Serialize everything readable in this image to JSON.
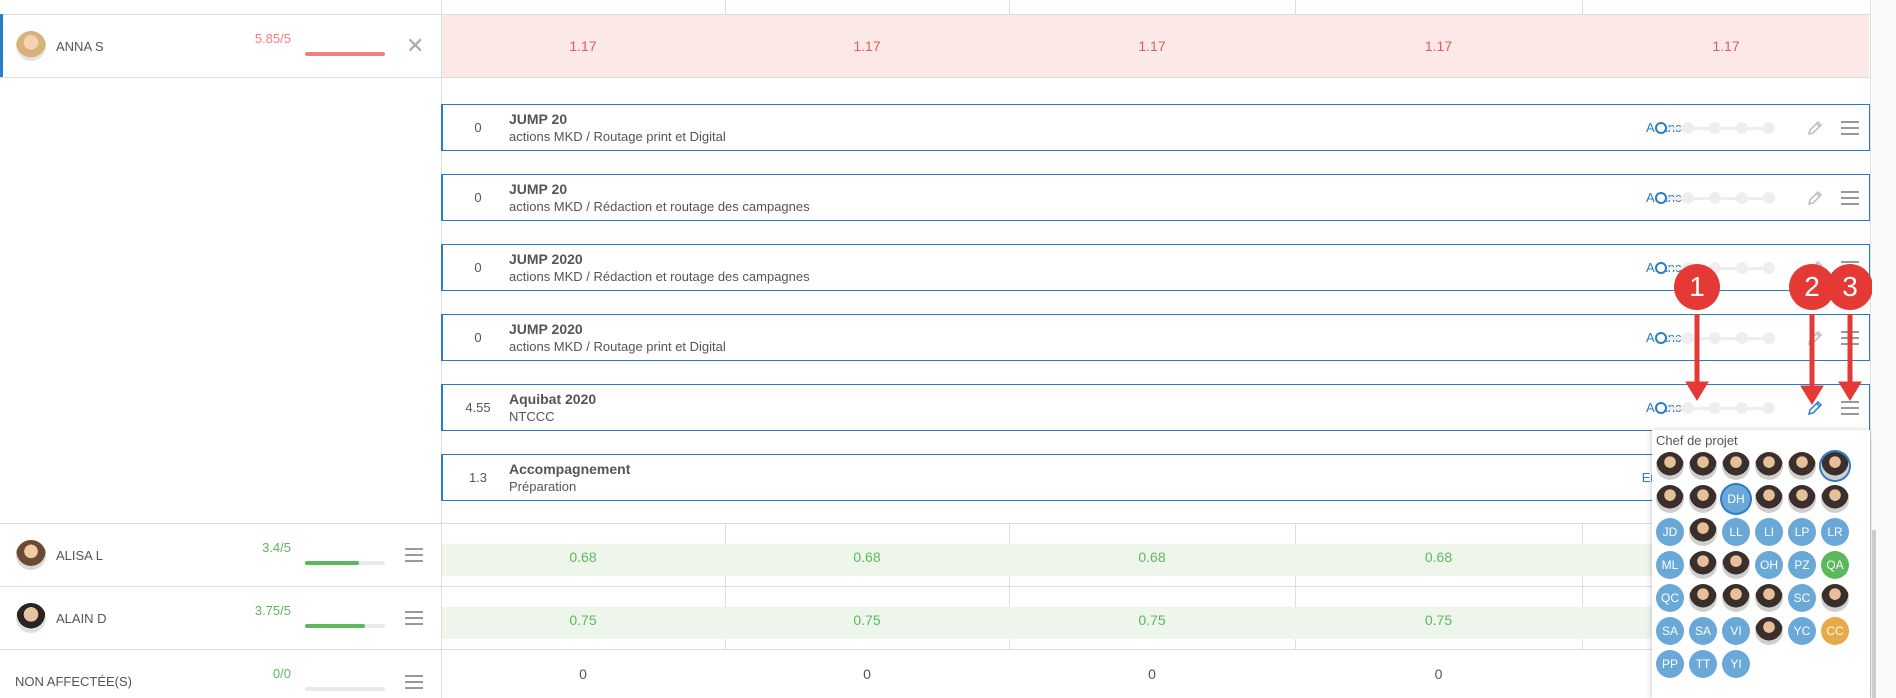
{
  "people": [
    {
      "name": "ANNA S",
      "score": "5.85/5",
      "score_color": "#f08080",
      "bar_fraction": 1.0,
      "action": "close"
    },
    {
      "name": "ALISA L",
      "score": "3.4/5",
      "score_color": "#5cb85c",
      "bar_fraction": 0.68,
      "action": "menu"
    },
    {
      "name": "ALAIN D",
      "score": "3.75/5",
      "score_color": "#5cb85c",
      "bar_fraction": 0.75,
      "action": "menu"
    },
    {
      "name": "NON AFFECTÉE(S)",
      "score": "0/0",
      "score_color": "#5cb85c",
      "bar_fraction": 0.0,
      "action": "menu"
    }
  ],
  "grid_rows": [
    {
      "values": [
        "1.17",
        "1.17",
        "1.17",
        "1.17",
        "1.17"
      ],
      "color": "#e05c5c",
      "bg": "#fde8e8"
    },
    {
      "values": [
        "0.68",
        "0.68",
        "0.68",
        "0.68",
        ""
      ],
      "color": "#5cb85c",
      "bg": "#eef6ec"
    },
    {
      "values": [
        "0.75",
        "0.75",
        "0.75",
        "0.75",
        ""
      ],
      "color": "#5cb85c",
      "bg": "#eef6ec"
    },
    {
      "values": [
        "0",
        "0",
        "0",
        "0",
        ""
      ],
      "color": "#555555",
      "bg": "#ffffff"
    }
  ],
  "tasks": [
    {
      "num": "0",
      "title": "JUMP 20",
      "subtitle": "actions MKD / Routage print et Digital",
      "status": "A lancer"
    },
    {
      "num": "0",
      "title": "JUMP 20",
      "subtitle": "actions MKD / Rédaction et routage des campagnes",
      "status": "A lancer"
    },
    {
      "num": "0",
      "title": "JUMP 2020",
      "subtitle": "actions MKD / Rédaction et routage des campagnes",
      "status": "A lancer"
    },
    {
      "num": "0",
      "title": "JUMP 2020",
      "subtitle": "actions MKD / Routage print et Digital",
      "status": "A lancer"
    },
    {
      "num": "4.55",
      "title": "Aquibat 2020",
      "subtitle": "NTCCC",
      "status": "A lancer"
    },
    {
      "num": "1.3",
      "title": "Accompagnement",
      "subtitle": "Préparation",
      "status": "En cours"
    }
  ],
  "popup": {
    "title": "Chef de projet",
    "chips": [
      [
        "photo",
        "photo",
        "photo",
        "photo",
        "photo",
        "photo-selected"
      ],
      [
        "photo",
        "photo",
        "DH",
        "photo",
        "photo",
        "photo"
      ],
      [
        "JD",
        "photo",
        "LL",
        "LI",
        "LP",
        "LR"
      ],
      [
        "ML",
        "photo",
        "photo",
        "OH",
        "PZ",
        "QA"
      ],
      [
        "QC",
        "photo",
        "photo",
        "photo",
        "SC",
        "photo"
      ],
      [
        "SA",
        "SA",
        "VI",
        "photo",
        "YC",
        "CC"
      ],
      [
        "PP",
        "TT",
        "YI"
      ]
    ],
    "chip_colors": {
      "default": "#6aa8d8",
      "QA": "#5cb85c",
      "CC": "#e8a94a"
    }
  },
  "markers": [
    "1",
    "2",
    "3"
  ],
  "colors": {
    "accent": "#2a7cc7",
    "marker": "#e53935"
  }
}
